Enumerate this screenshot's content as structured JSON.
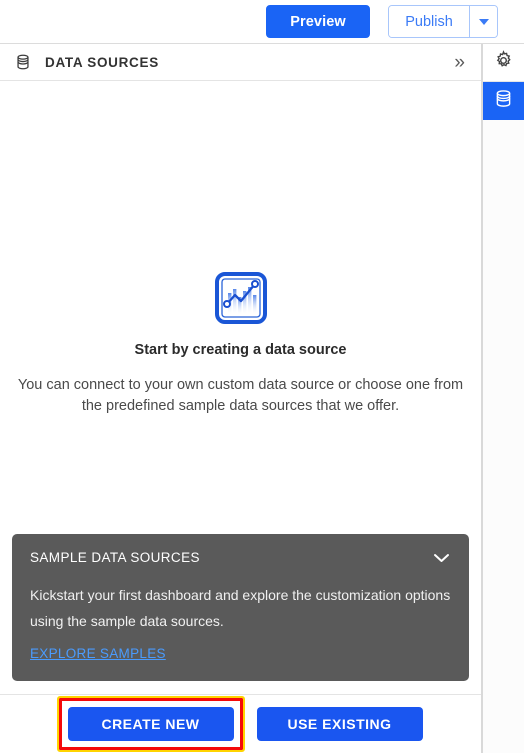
{
  "topbar": {
    "preview_label": "Preview",
    "publish_label": "Publish",
    "dropdown_icon": "chevron-down-icon"
  },
  "rail": {
    "items": [
      {
        "icon": "gear-icon",
        "name": "settings",
        "active": false
      },
      {
        "icon": "database-icon",
        "name": "data-sources",
        "active": true
      }
    ]
  },
  "panel": {
    "header": {
      "icon": "database-icon",
      "title": "DATA SOURCES",
      "collapse_icon": "»"
    },
    "empty_state": {
      "illustration": "line-chart-icon",
      "title": "Start by creating a data source",
      "description": "You can connect to your own custom data source or choose one from the predefined sample data sources that we offer."
    },
    "sample_card": {
      "title": "SAMPLE DATA SOURCES",
      "chevron_icon": "chevron-down-icon",
      "body": "Kickstart your first dashboard and explore the customization options using the sample data sources.",
      "link_label": "EXPLORE SAMPLES"
    },
    "footer": {
      "create_new_label": "CREATE NEW",
      "use_existing_label": "USE EXISTING"
    }
  },
  "colors": {
    "primary_blue": "#1a56f0",
    "preview_blue": "#1a64f5",
    "publish_text": "#3b7bf6",
    "card_gray": "#5a5a5a",
    "link_blue": "#4a9bfd",
    "highlight_red": "#f40a0a",
    "highlight_yellow": "#ffd400"
  }
}
